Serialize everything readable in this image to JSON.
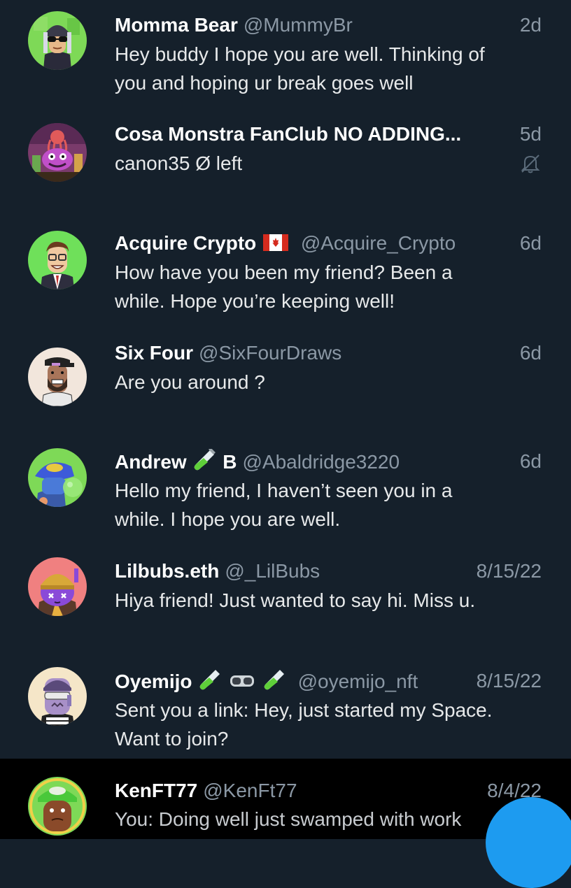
{
  "conversations": [
    {
      "name": "Momma Bear",
      "handle": "@MummyBr",
      "time": "2d",
      "line1": "Hey buddy I hope you are well. Thinking of",
      "line2": "you and hoping ur break goes well",
      "avatar_icon": "avatar-glasses-character",
      "avatar_bg": "#7ed957"
    },
    {
      "name": "Cosa Monstra FanClub NO ADDING...",
      "handle": "",
      "time": "5d",
      "line1": "canon35 Ø left",
      "line2": "",
      "muted": true,
      "avatar_icon": "avatar-monster-group",
      "avatar_bg": "#7a3b6b"
    },
    {
      "name": "Acquire Crypto",
      "handle": "@Acquire_Crypto",
      "time": "6d",
      "flag": "canada-flag-icon",
      "line1": "How have you been my friend? Been a",
      "line2": "while. Hope you’re keeping well!",
      "avatar_icon": "avatar-businessman",
      "avatar_bg": "#6fe05a"
    },
    {
      "name": "Six Four",
      "handle": "@SixFourDraws",
      "time": "6d",
      "line1": "Are you around ?",
      "line2": "",
      "avatar_icon": "avatar-bearded-cap",
      "avatar_bg": "#f2e6dc"
    },
    {
      "name_a": "Andrew",
      "name_b": "B",
      "handle": "@Abaldridge3220",
      "time": "6d",
      "line1": "Hello my friend, I haven’t seen you in a",
      "line2": "while. I hope you are well.",
      "avatar_icon": "avatar-blue-hat",
      "avatar_bg": "#7ed957"
    },
    {
      "name": "Lilbubs.eth",
      "handle": "@_LilBubs",
      "time": "8/15/22",
      "line1": "Hiya friend! Just wanted to say hi. Miss u.",
      "line2": "",
      "avatar_icon": "avatar-purple-beanie",
      "avatar_bg": "#f08080"
    },
    {
      "name": "Oyemijo",
      "handle": "@oyemijo_nft",
      "time": "8/15/22",
      "line1": "Sent you a link: Hey, just started my Space.",
      "line2": "Want to join?",
      "avatar_icon": "avatar-goggles",
      "avatar_bg": "#f5e6c8"
    },
    {
      "name": "KenFT77",
      "handle": "@KenFt77",
      "time": "8/4/22",
      "line1": "You: Doing well just swamped with work",
      "line2": "",
      "avatar_icon": "avatar-green-cap",
      "avatar_bg": "#7ed957"
    }
  ],
  "colors": {
    "background": "#15202b",
    "selected_row": "#000000",
    "secondary_text": "#8b98a5",
    "accent": "#1d9bf0"
  }
}
